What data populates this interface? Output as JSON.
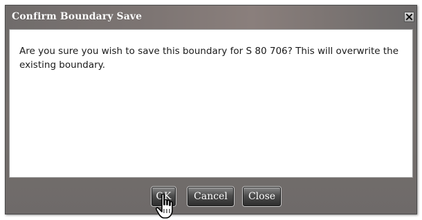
{
  "dialog": {
    "title": "Confirm Boundary Save",
    "message": "Are you sure you wish to save this boundary for S 80 706? This will overwrite the existing boundary.",
    "buttons": {
      "ok": "OK",
      "cancel": "Cancel",
      "close": "Close"
    },
    "icons": {
      "title_close": "close-icon",
      "pointer": "hand-pointer-icon"
    }
  }
}
